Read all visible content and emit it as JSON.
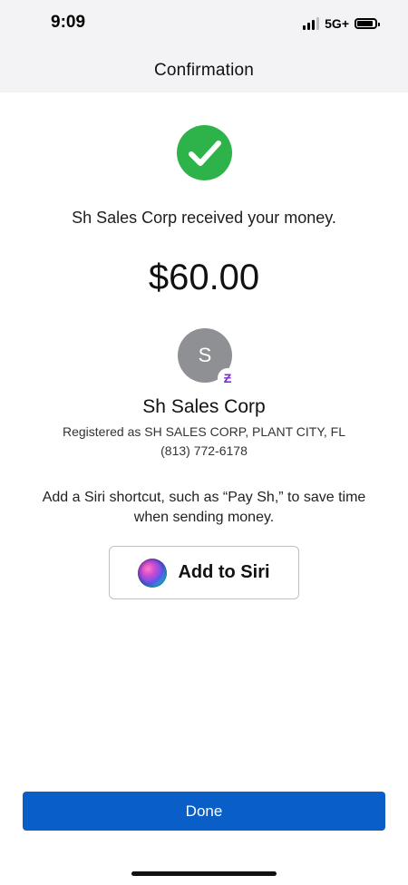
{
  "status_bar": {
    "time": "9:09",
    "network": "5G+",
    "signal_bars": 3,
    "icons": [
      "signal-icon",
      "battery-icon"
    ]
  },
  "navbar": {
    "title": "Confirmation"
  },
  "confirmation": {
    "icon": "checkmark-icon",
    "message": "Sh Sales Corp received your money.",
    "amount": "$60.00"
  },
  "merchant": {
    "avatar_initial": "S",
    "badge_symbol": "Ƶ",
    "name": "Sh Sales Corp",
    "registered": "Registered as SH SALES CORP, PLANT CITY, FL",
    "phone": "(813) 772-6178"
  },
  "siri": {
    "prompt": "Add a Siri shortcut, such as “Pay Sh,” to save time when sending money.",
    "button_label": "Add to Siri",
    "icon": "siri-icon"
  },
  "actions": {
    "done_label": "Done"
  },
  "colors": {
    "success": "#2eb34a",
    "primary": "#0a5ec7",
    "avatar": "#8f9094",
    "cash_badge": "#7b2fd6"
  }
}
